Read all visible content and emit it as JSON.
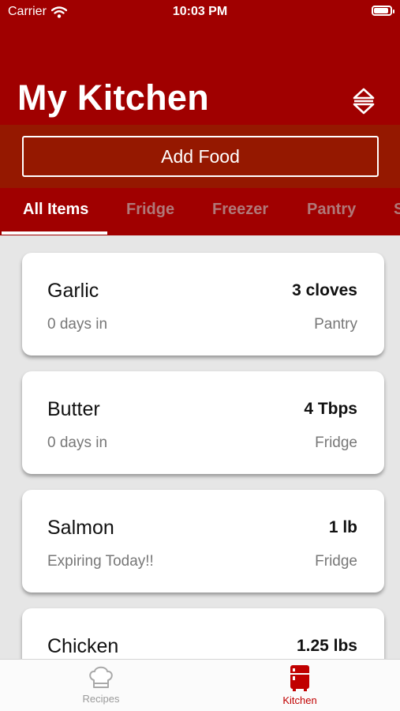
{
  "status_bar": {
    "carrier": "Carrier",
    "time": "10:03 PM",
    "battery_level": 0.9
  },
  "header": {
    "title": "My Kitchen",
    "sort_icon": "sort-icon"
  },
  "actions": {
    "add_food_label": "Add Food"
  },
  "tabs": [
    {
      "label": "All Items",
      "active": true
    },
    {
      "label": "Fridge",
      "active": false
    },
    {
      "label": "Freezer",
      "active": false
    },
    {
      "label": "Pantry",
      "active": false
    },
    {
      "label": "S",
      "active": false
    }
  ],
  "items": [
    {
      "name": "Garlic",
      "quantity": "3 cloves",
      "age": "0 days in",
      "location": "Pantry"
    },
    {
      "name": "Butter",
      "quantity": "4 Tbps",
      "age": "0 days in",
      "location": "Fridge"
    },
    {
      "name": "Salmon",
      "quantity": "1 lb",
      "age": "Expiring Today!!",
      "location": "Fridge"
    },
    {
      "name": "Chicken",
      "quantity": "1.25 lbs",
      "age": "",
      "location": ""
    }
  ],
  "tab_bar": [
    {
      "label": "Recipes",
      "icon": "chef-hat-icon",
      "active": false
    },
    {
      "label": "Kitchen",
      "icon": "fridge-icon",
      "active": true
    }
  ],
  "colors": {
    "brand": "#a00000",
    "add_strip": "#951800",
    "inactive_tab": "#b07878",
    "tabbar_inactive": "#9a9a9a"
  }
}
